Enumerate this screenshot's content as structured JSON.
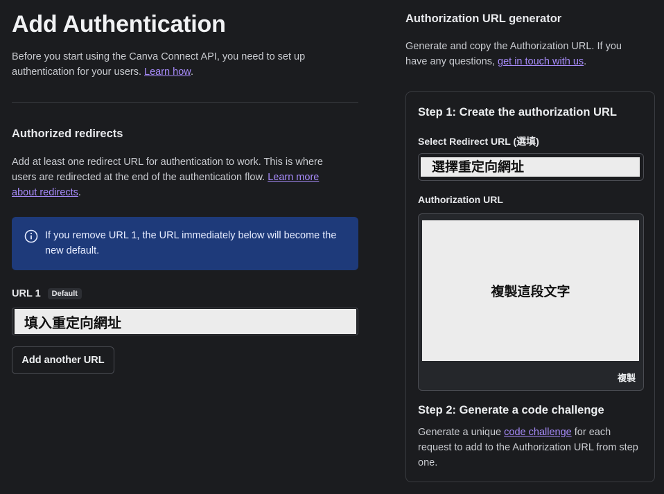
{
  "left": {
    "title": "Add Authentication",
    "intro_text": "Before you start using the Canva Connect API, you need to set up authentication for your users. ",
    "intro_link": "Learn how",
    "intro_end": ".",
    "redirects_title": "Authorized redirects",
    "redirects_text": "Add at least one redirect URL for authentication to work. This is where users are redirected at the end of the authentication flow. ",
    "redirects_link": "Learn more about redirects",
    "redirects_end": ".",
    "notice_text": "If you remove URL 1, the URL immediately below will become the new default.",
    "url1_label": "URL 1",
    "url1_badge": "Default",
    "url1_value": "填入重定向網址",
    "add_url_button": "Add another URL"
  },
  "right": {
    "title": "Authorization URL generator",
    "desc_text": "Generate and copy the Authorization URL. If you have any questions, ",
    "desc_link": "get in touch with us",
    "desc_end": ".",
    "step1_title": "Step 1: Create the authorization URL",
    "select_label": "Select Redirect URL (選填)",
    "select_value": "選擇重定向網址",
    "auth_url_label": "Authorization URL",
    "auth_url_value": "複製這段文字",
    "copy_button": "複製",
    "step2_title": "Step 2: Generate a code challenge",
    "step2_text_a": "Generate a unique ",
    "step2_link": "code challenge",
    "step2_text_b": " for each request to add to the Authorization URL from step one."
  },
  "colors": {
    "background": "#1b1c1f",
    "link": "#a78bfa",
    "notice_background": "#1e3a7a"
  },
  "icons": {
    "notice_icon": "info-icon"
  }
}
